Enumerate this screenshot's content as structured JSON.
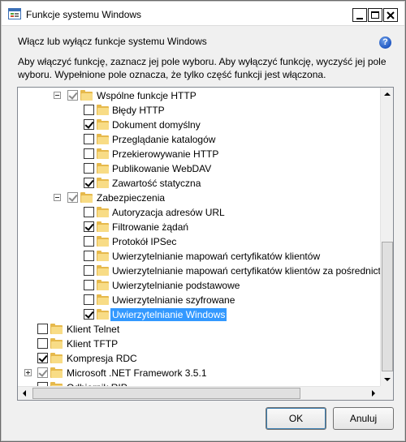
{
  "window": {
    "title": "Funkcje systemu Windows",
    "icon": "windows-features-icon",
    "controls": [
      "minimize-icon",
      "maximize-icon",
      "close-icon"
    ]
  },
  "header": {
    "heading": "Włącz lub wyłącz funkcje systemu Windows",
    "help_icon": "help-icon",
    "help_glyph": "?",
    "description": "Aby włączyć funkcję, zaznacz jej pole wyboru. Aby wyłączyć funkcję, wyczyść jej pole wyboru. Wypełnione pole oznacza, że tylko część funkcji jest włączona."
  },
  "tree": {
    "items": [
      {
        "label": "Wspólne funkcje HTTP",
        "state": "partial",
        "expander": "minus",
        "level": 1
      },
      {
        "label": "Błędy HTTP",
        "state": "unchecked",
        "level": 2
      },
      {
        "label": "Dokument domyślny",
        "state": "checked",
        "level": 2
      },
      {
        "label": "Przeglądanie katalogów",
        "state": "unchecked",
        "level": 2
      },
      {
        "label": "Przekierowywanie HTTP",
        "state": "unchecked",
        "level": 2
      },
      {
        "label": "Publikowanie WebDAV",
        "state": "unchecked",
        "level": 2
      },
      {
        "label": "Zawartość statyczna",
        "state": "checked",
        "level": 2
      },
      {
        "label": "Zabezpieczenia",
        "state": "partial",
        "expander": "minus",
        "level": 1
      },
      {
        "label": "Autoryzacja adresów URL",
        "state": "unchecked",
        "level": 2
      },
      {
        "label": "Filtrowanie żądań",
        "state": "checked",
        "level": 2
      },
      {
        "label": "Protokół IPSec",
        "state": "unchecked",
        "level": 2
      },
      {
        "label": "Uwierzytelnianie mapowań certyfikatów klientów",
        "state": "unchecked",
        "level": 2
      },
      {
        "label": "Uwierzytelnianie mapowań certyfikatów klientów za pośrednict",
        "state": "unchecked",
        "level": 2
      },
      {
        "label": "Uwierzytelnianie podstawowe",
        "state": "unchecked",
        "level": 2
      },
      {
        "label": "Uwierzytelnianie szyfrowane",
        "state": "unchecked",
        "level": 2
      },
      {
        "label": "Uwierzytelnianie Windows",
        "state": "checked",
        "level": 2,
        "selected": true
      },
      {
        "label": "Klient Telnet",
        "state": "unchecked",
        "level": 0
      },
      {
        "label": "Klient TFTP",
        "state": "unchecked",
        "level": 0
      },
      {
        "label": "Kompresja RDC",
        "state": "checked",
        "level": 0
      },
      {
        "label": "Microsoft .NET Framework 3.5.1",
        "state": "partial",
        "expander": "plus",
        "level": 0
      },
      {
        "label": "Odbiornik RIP",
        "state": "unchecked",
        "level": 0
      }
    ],
    "selection_color": "#3399ff",
    "folder_color": "#e6b94c"
  },
  "buttons": {
    "ok": "OK",
    "cancel": "Anuluj"
  }
}
